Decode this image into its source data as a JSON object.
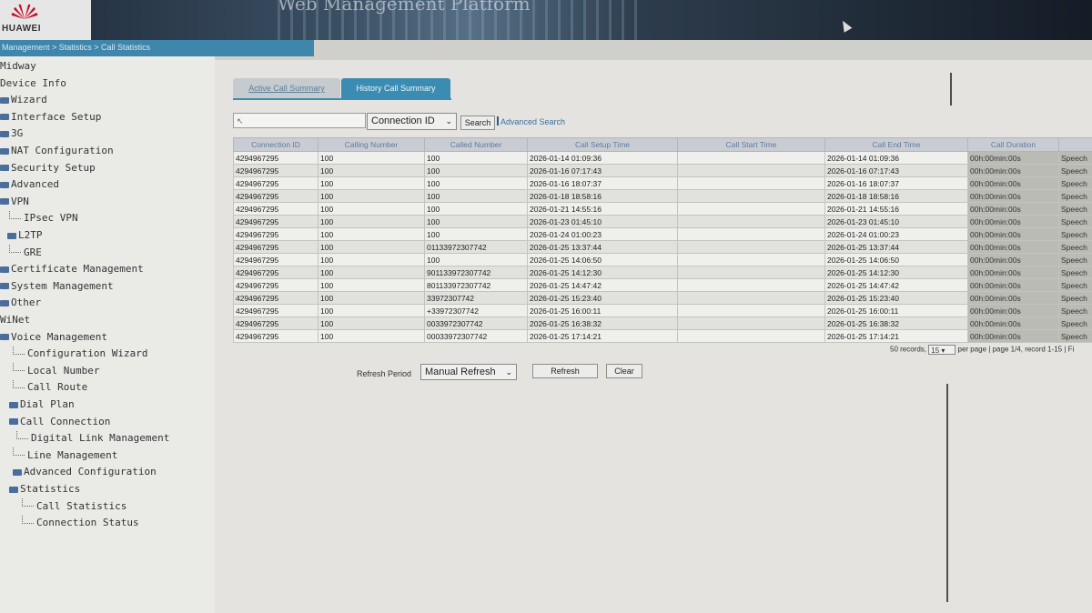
{
  "header": {
    "brand": "HUAWEI",
    "title": "Web Management Platform"
  },
  "breadcrumb": "Management > Statistics > Call Statistics",
  "sidebar": {
    "items": [
      {
        "label": "Midway",
        "icon": ""
      },
      {
        "label": "Device Info",
        "icon": ""
      },
      {
        "label": "Wizard",
        "icon": "folder-icon"
      },
      {
        "label": "Interface Setup",
        "icon": "folder-icon"
      },
      {
        "label": "3G",
        "icon": "folder-icon"
      },
      {
        "label": "NAT Configuration",
        "icon": "folder-icon"
      },
      {
        "label": "Security Setup",
        "icon": "folder-icon"
      },
      {
        "label": "Advanced",
        "icon": "folder-icon"
      },
      {
        "label": "VPN",
        "icon": "folder-icon"
      },
      {
        "label": "IPsec VPN",
        "icon": "tree-icon"
      },
      {
        "label": "L2TP",
        "icon": "folder-icon"
      },
      {
        "label": "GRE",
        "icon": "tree-icon"
      },
      {
        "label": "Certificate Management",
        "icon": "folder-icon"
      },
      {
        "label": "System Management",
        "icon": "folder-icon"
      },
      {
        "label": "Other",
        "icon": "folder-icon"
      },
      {
        "label": "WiNet",
        "icon": ""
      },
      {
        "label": "Voice Management",
        "icon": "folder-icon"
      },
      {
        "label": "Configuration Wizard",
        "icon": "tree-icon"
      },
      {
        "label": "Local Number",
        "icon": "tree-icon"
      },
      {
        "label": "Call Route",
        "icon": "tree-icon"
      },
      {
        "label": "Dial Plan",
        "icon": "folder-icon"
      },
      {
        "label": "Call Connection",
        "icon": "folder-icon"
      },
      {
        "label": "Digital Link Management",
        "icon": "tree-icon"
      },
      {
        "label": "Line Management",
        "icon": "tree-icon"
      },
      {
        "label": "Advanced Configuration",
        "icon": "folder-icon"
      },
      {
        "label": "Statistics",
        "icon": "folder-icon"
      },
      {
        "label": "Call Statistics",
        "icon": "tree-icon"
      },
      {
        "label": "Connection Status",
        "icon": "tree-icon"
      }
    ]
  },
  "tabs": {
    "active_call": "Active Call Summary",
    "history_call": "History Call Summary"
  },
  "search": {
    "placeholder": "",
    "field_select": "Connection ID",
    "search_button": "Search",
    "advanced_link": "Advanced Search"
  },
  "table": {
    "columns": [
      "Connection ID",
      "Calling Number",
      "Called Number",
      "Call Setup Time",
      "Call Start Time",
      "Call End Time",
      "Call Duration",
      ""
    ],
    "rows": [
      [
        "4294967295",
        "100",
        "100",
        "2026-01-14 01:09:36",
        "",
        "2026-01-14 01:09:36",
        "00h:00min:00s",
        "Speech"
      ],
      [
        "4294967295",
        "100",
        "100",
        "2026-01-16 07:17:43",
        "",
        "2026-01-16 07:17:43",
        "00h:00min:00s",
        "Speech"
      ],
      [
        "4294967295",
        "100",
        "100",
        "2026-01-16 18:07:37",
        "",
        "2026-01-16 18:07:37",
        "00h:00min:00s",
        "Speech"
      ],
      [
        "4294967295",
        "100",
        "100",
        "2026-01-18 18:58:16",
        "",
        "2026-01-18 18:58:16",
        "00h:00min:00s",
        "Speech"
      ],
      [
        "4294967295",
        "100",
        "100",
        "2026-01-21 14:55:16",
        "",
        "2026-01-21 14:55:16",
        "00h:00min:00s",
        "Speech"
      ],
      [
        "4294967295",
        "100",
        "100",
        "2026-01-23 01:45:10",
        "",
        "2026-01-23 01:45:10",
        "00h:00min:00s",
        "Speech"
      ],
      [
        "4294967295",
        "100",
        "100",
        "2026-01-24 01:00:23",
        "",
        "2026-01-24 01:00:23",
        "00h:00min:00s",
        "Speech"
      ],
      [
        "4294967295",
        "100",
        "01133972307742",
        "2026-01-25 13:37:44",
        "",
        "2026-01-25 13:37:44",
        "00h:00min:00s",
        "Speech"
      ],
      [
        "4294967295",
        "100",
        "100",
        "2026-01-25 14:06:50",
        "",
        "2026-01-25 14:06:50",
        "00h:00min:00s",
        "Speech"
      ],
      [
        "4294967295",
        "100",
        "901133972307742",
        "2026-01-25 14:12:30",
        "",
        "2026-01-25 14:12:30",
        "00h:00min:00s",
        "Speech"
      ],
      [
        "4294967295",
        "100",
        "801133972307742",
        "2026-01-25 14:47:42",
        "",
        "2026-01-25 14:47:42",
        "00h:00min:00s",
        "Speech"
      ],
      [
        "4294967295",
        "100",
        "33972307742",
        "2026-01-25 15:23:40",
        "",
        "2026-01-25 15:23:40",
        "00h:00min:00s",
        "Speech"
      ],
      [
        "4294967295",
        "100",
        "+33972307742",
        "2026-01-25 16:00:11",
        "",
        "2026-01-25 16:00:11",
        "00h:00min:00s",
        "Speech"
      ],
      [
        "4294967295",
        "100",
        "0033972307742",
        "2026-01-25 16:38:32",
        "",
        "2026-01-25 16:38:32",
        "00h:00min:00s",
        "Speech"
      ],
      [
        "4294967295",
        "100",
        "00033972307742",
        "2026-01-25 17:14:21",
        "",
        "2026-01-25 17:14:21",
        "00h:00min:00s",
        "Speech"
      ]
    ]
  },
  "pager": {
    "records": "50 records,",
    "page_size": "15",
    "tail": "per page | page 1/4, record 1-15 | Fi"
  },
  "refresh": {
    "label": "Refresh Period",
    "period": "Manual Refresh",
    "refresh_button": "Refresh",
    "clear_button": "Clear"
  },
  "colors": {
    "accent": "#3a8cb2",
    "link": "#3a6fa6"
  }
}
